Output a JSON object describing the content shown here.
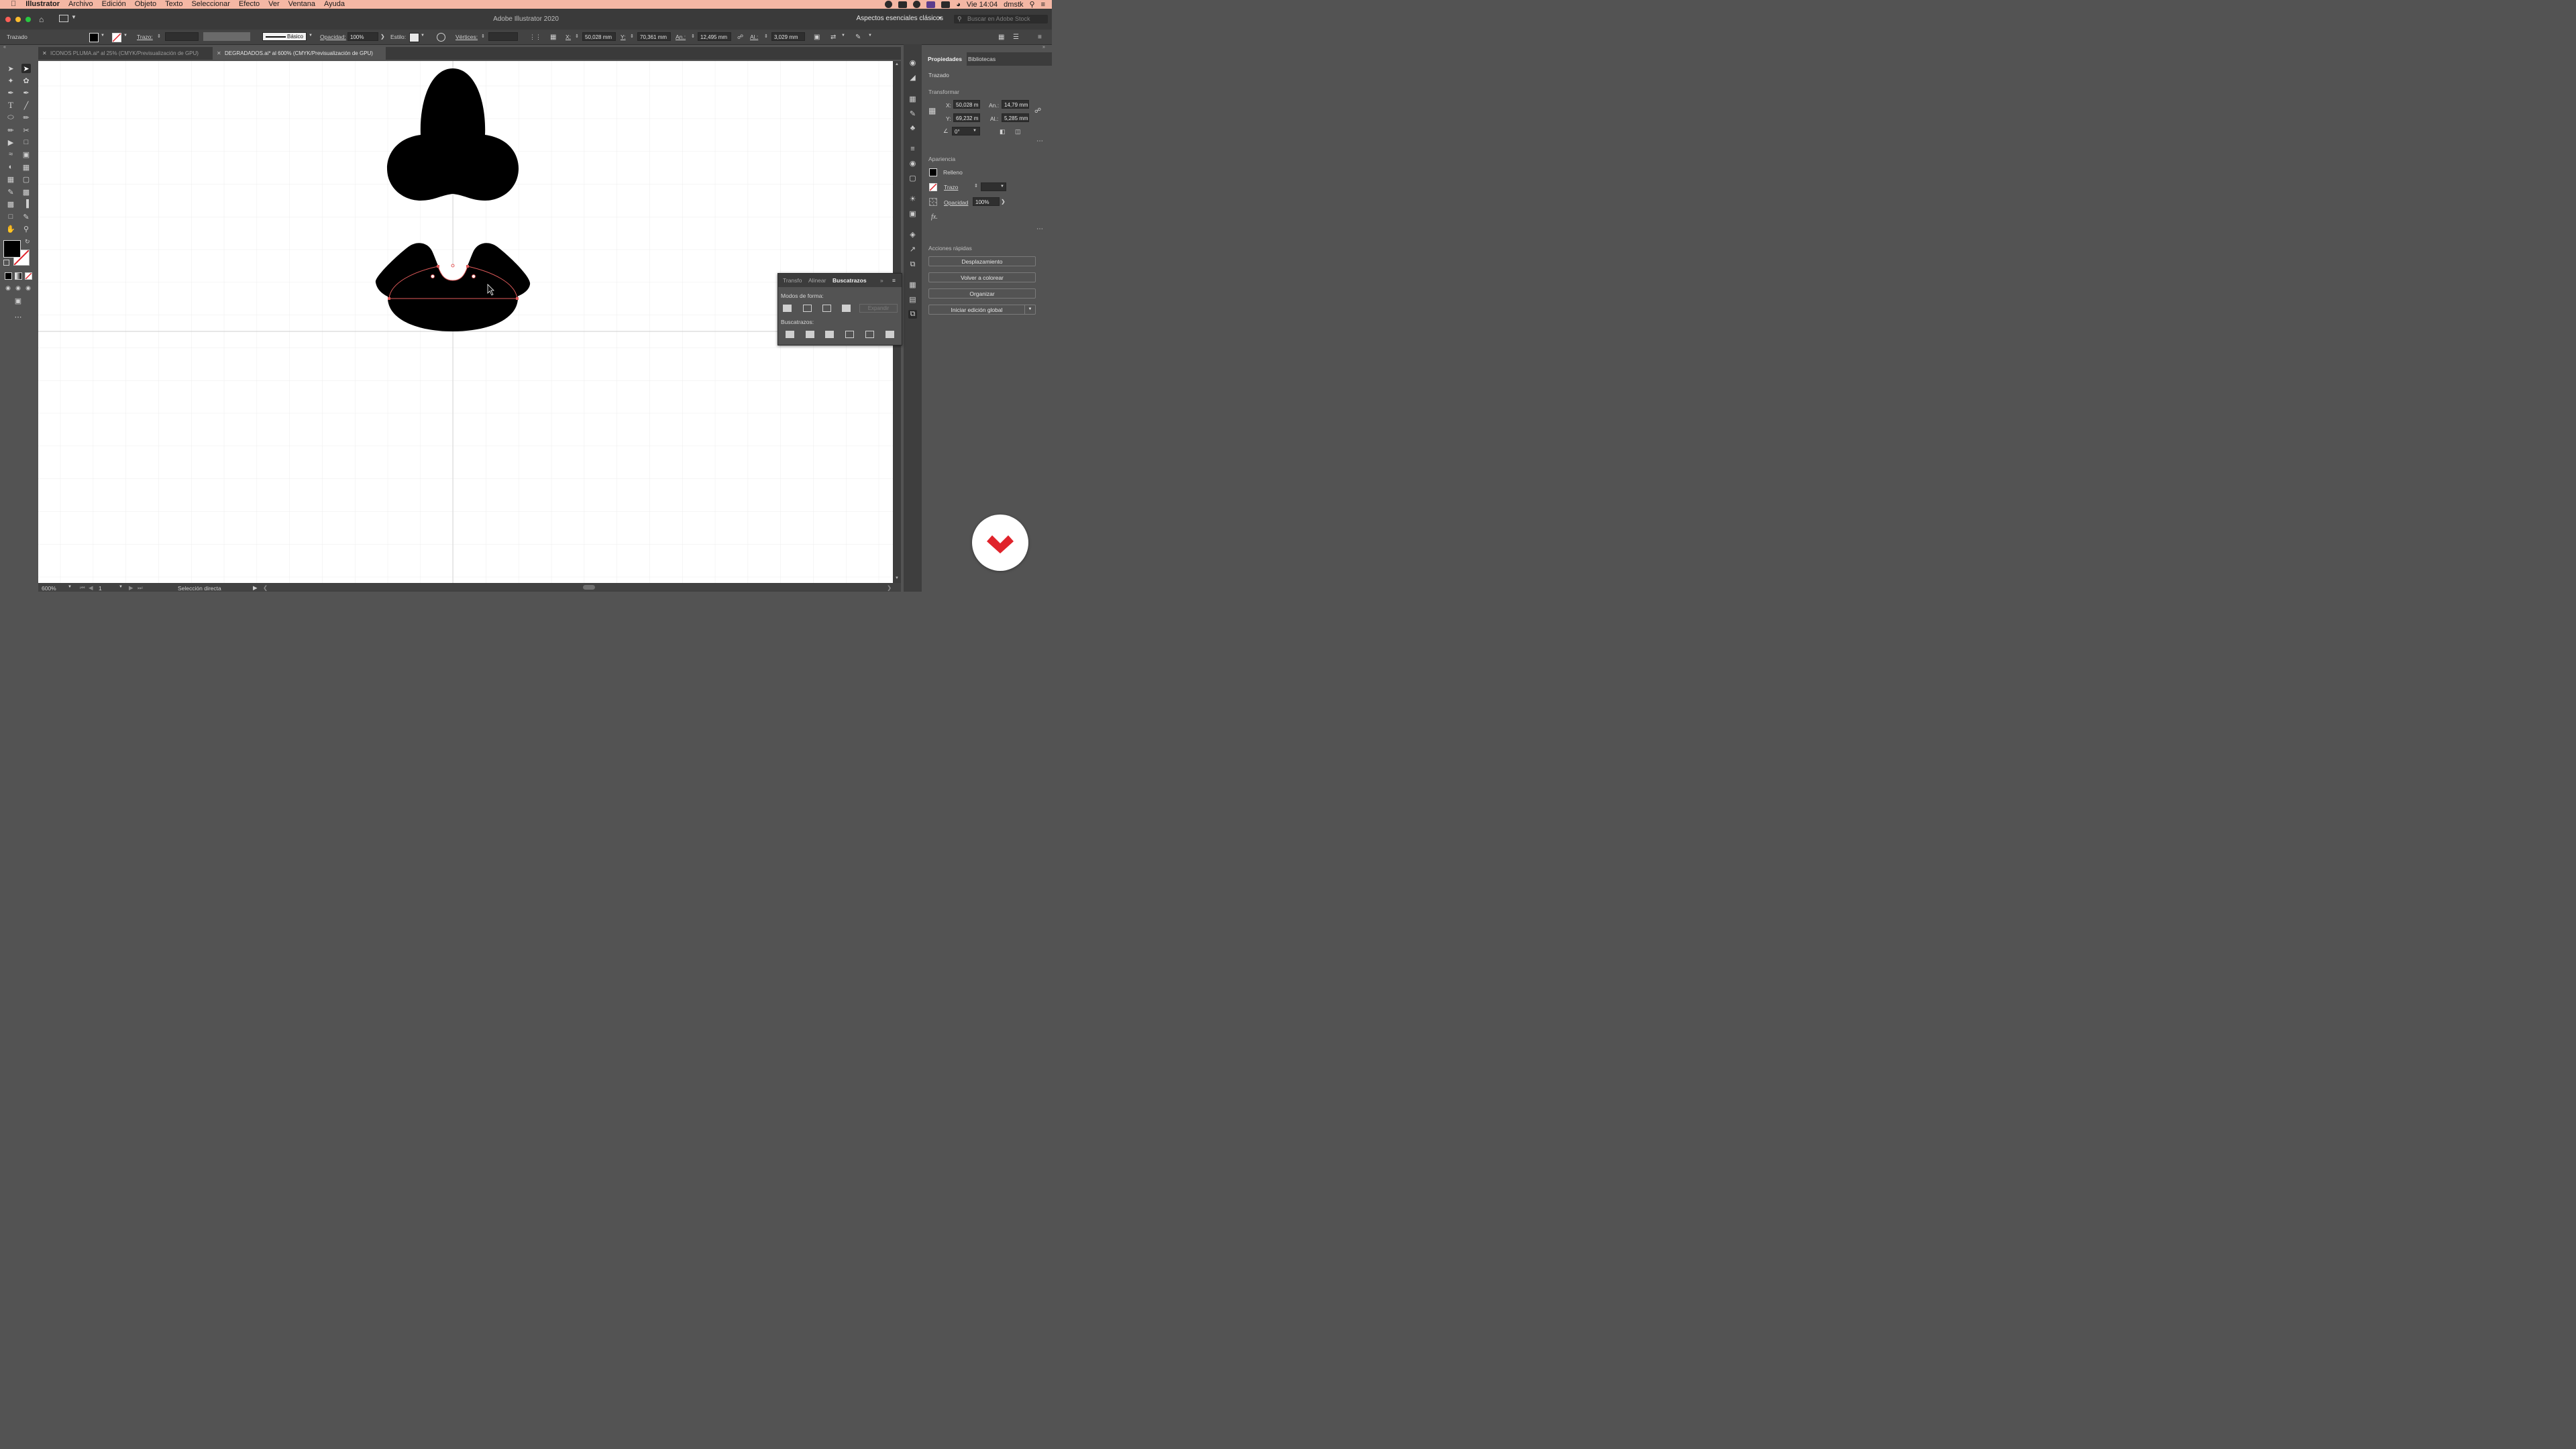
{
  "menubar": {
    "app": "Illustrator",
    "items": [
      "Archivo",
      "Edición",
      "Objeto",
      "Texto",
      "Seleccionar",
      "Efecto",
      "Ver",
      "Ventana",
      "Ayuda"
    ],
    "clock": "Vie 14:04",
    "user": "dmstk"
  },
  "window": {
    "title": "Adobe Illustrator 2020",
    "workspace": "Aspectos esenciales clásicos",
    "stock_placeholder": "Buscar en Adobe Stock"
  },
  "controlbar": {
    "object_type": "Trazado",
    "stroke_label": "Trazo:",
    "brush_label": "Básico",
    "opacity_label": "Opacidad:",
    "opacity_value": "100%",
    "style_label": "Estilo:",
    "vertices_label": "Vértices:",
    "x_label": "X:",
    "x_value": "50,028 mm",
    "y_label": "Y:",
    "y_value": "70,361 mm",
    "w_label": "An.:",
    "w_value": "12,495 mm",
    "h_label": "Al.:",
    "h_value": "3,029 mm"
  },
  "tabs": [
    {
      "label": "ICONOS PLUMA.ai* al 25% (CMYK/Previsualización de GPU)",
      "active": false
    },
    {
      "label": "DEGRADADOS.ai* al 600% (CMYK/Previsualización de GPU)",
      "active": true
    }
  ],
  "statusbar": {
    "zoom": "600%",
    "artboard": "1",
    "tool": "Selección directa"
  },
  "properties": {
    "tabs": [
      "Propiedades",
      "Bibliotecas"
    ],
    "object": "Trazado",
    "transform_title": "Transformar",
    "x_label": "X:",
    "x_value": "50,028 m",
    "y_label": "Y:",
    "y_value": "69,232 m",
    "w_label": "An.:",
    "w_value": "14,79 mm",
    "h_label": "Al.:",
    "h_value": "5,285 mm",
    "angle_value": "0°",
    "appearance_title": "Apariencia",
    "fill_label": "Relleno",
    "stroke_label": "Trazo",
    "opacity_label": "Opacidad",
    "opacity_value": "100%",
    "fx_label": "fx.",
    "quick_title": "Acciones rápidas",
    "buttons": [
      "Desplazamiento",
      "Volver a colorear",
      "Organizar",
      "Iniciar edición global"
    ]
  },
  "pathfinder": {
    "tabs": [
      "Transfo",
      "Alinear",
      "Buscatrazos"
    ],
    "shape_modes_label": "Modos de forma:",
    "expand_label": "Expandir",
    "pathfinders_label": "Buscatrazos:"
  },
  "colors": {
    "menubar_bg": "#f4b7a4",
    "accent_red": "#e0232b",
    "selection_path": "#e05a5a",
    "ui_dark": "#535353"
  }
}
